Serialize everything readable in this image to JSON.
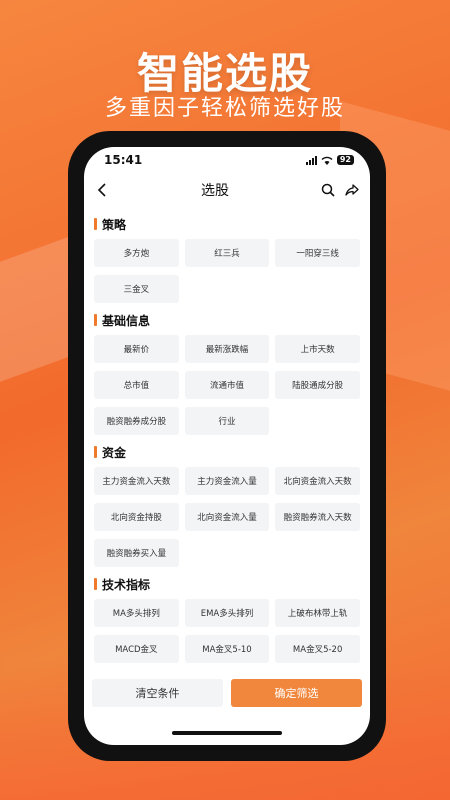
{
  "promo": {
    "title": "智能选股",
    "subtitle": "多重因子轻松筛选好股"
  },
  "status": {
    "time": "15:41",
    "battery": "92"
  },
  "nav": {
    "title": "选股"
  },
  "sections": [
    {
      "title": "策略",
      "items": [
        "多方炮",
        "红三兵",
        "一阳穿三线",
        "三金叉"
      ]
    },
    {
      "title": "基础信息",
      "items": [
        "最新价",
        "最新涨跌幅",
        "上市天数",
        "总市值",
        "流通市值",
        "陆股通成分股",
        "融资融券成分股",
        "行业"
      ]
    },
    {
      "title": "资金",
      "items": [
        "主力资金流入天数",
        "主力资金流入量",
        "北向资金流入天数",
        "北向资金持股",
        "北向资金流入量",
        "融资融券流入天数",
        "融资融券买入量"
      ]
    },
    {
      "title": "技术指标",
      "items": [
        "MA多头排列",
        "EMA多头排列",
        "上破布林带上轨",
        "MACD金叉",
        "MA金叉5-10",
        "MA金叉5-20"
      ]
    }
  ],
  "actions": {
    "clear_label": "清空条件",
    "confirm_label": "确定筛选"
  },
  "colors": {
    "accent": "#f0873c",
    "tag_bg": "#f3f4f6"
  }
}
